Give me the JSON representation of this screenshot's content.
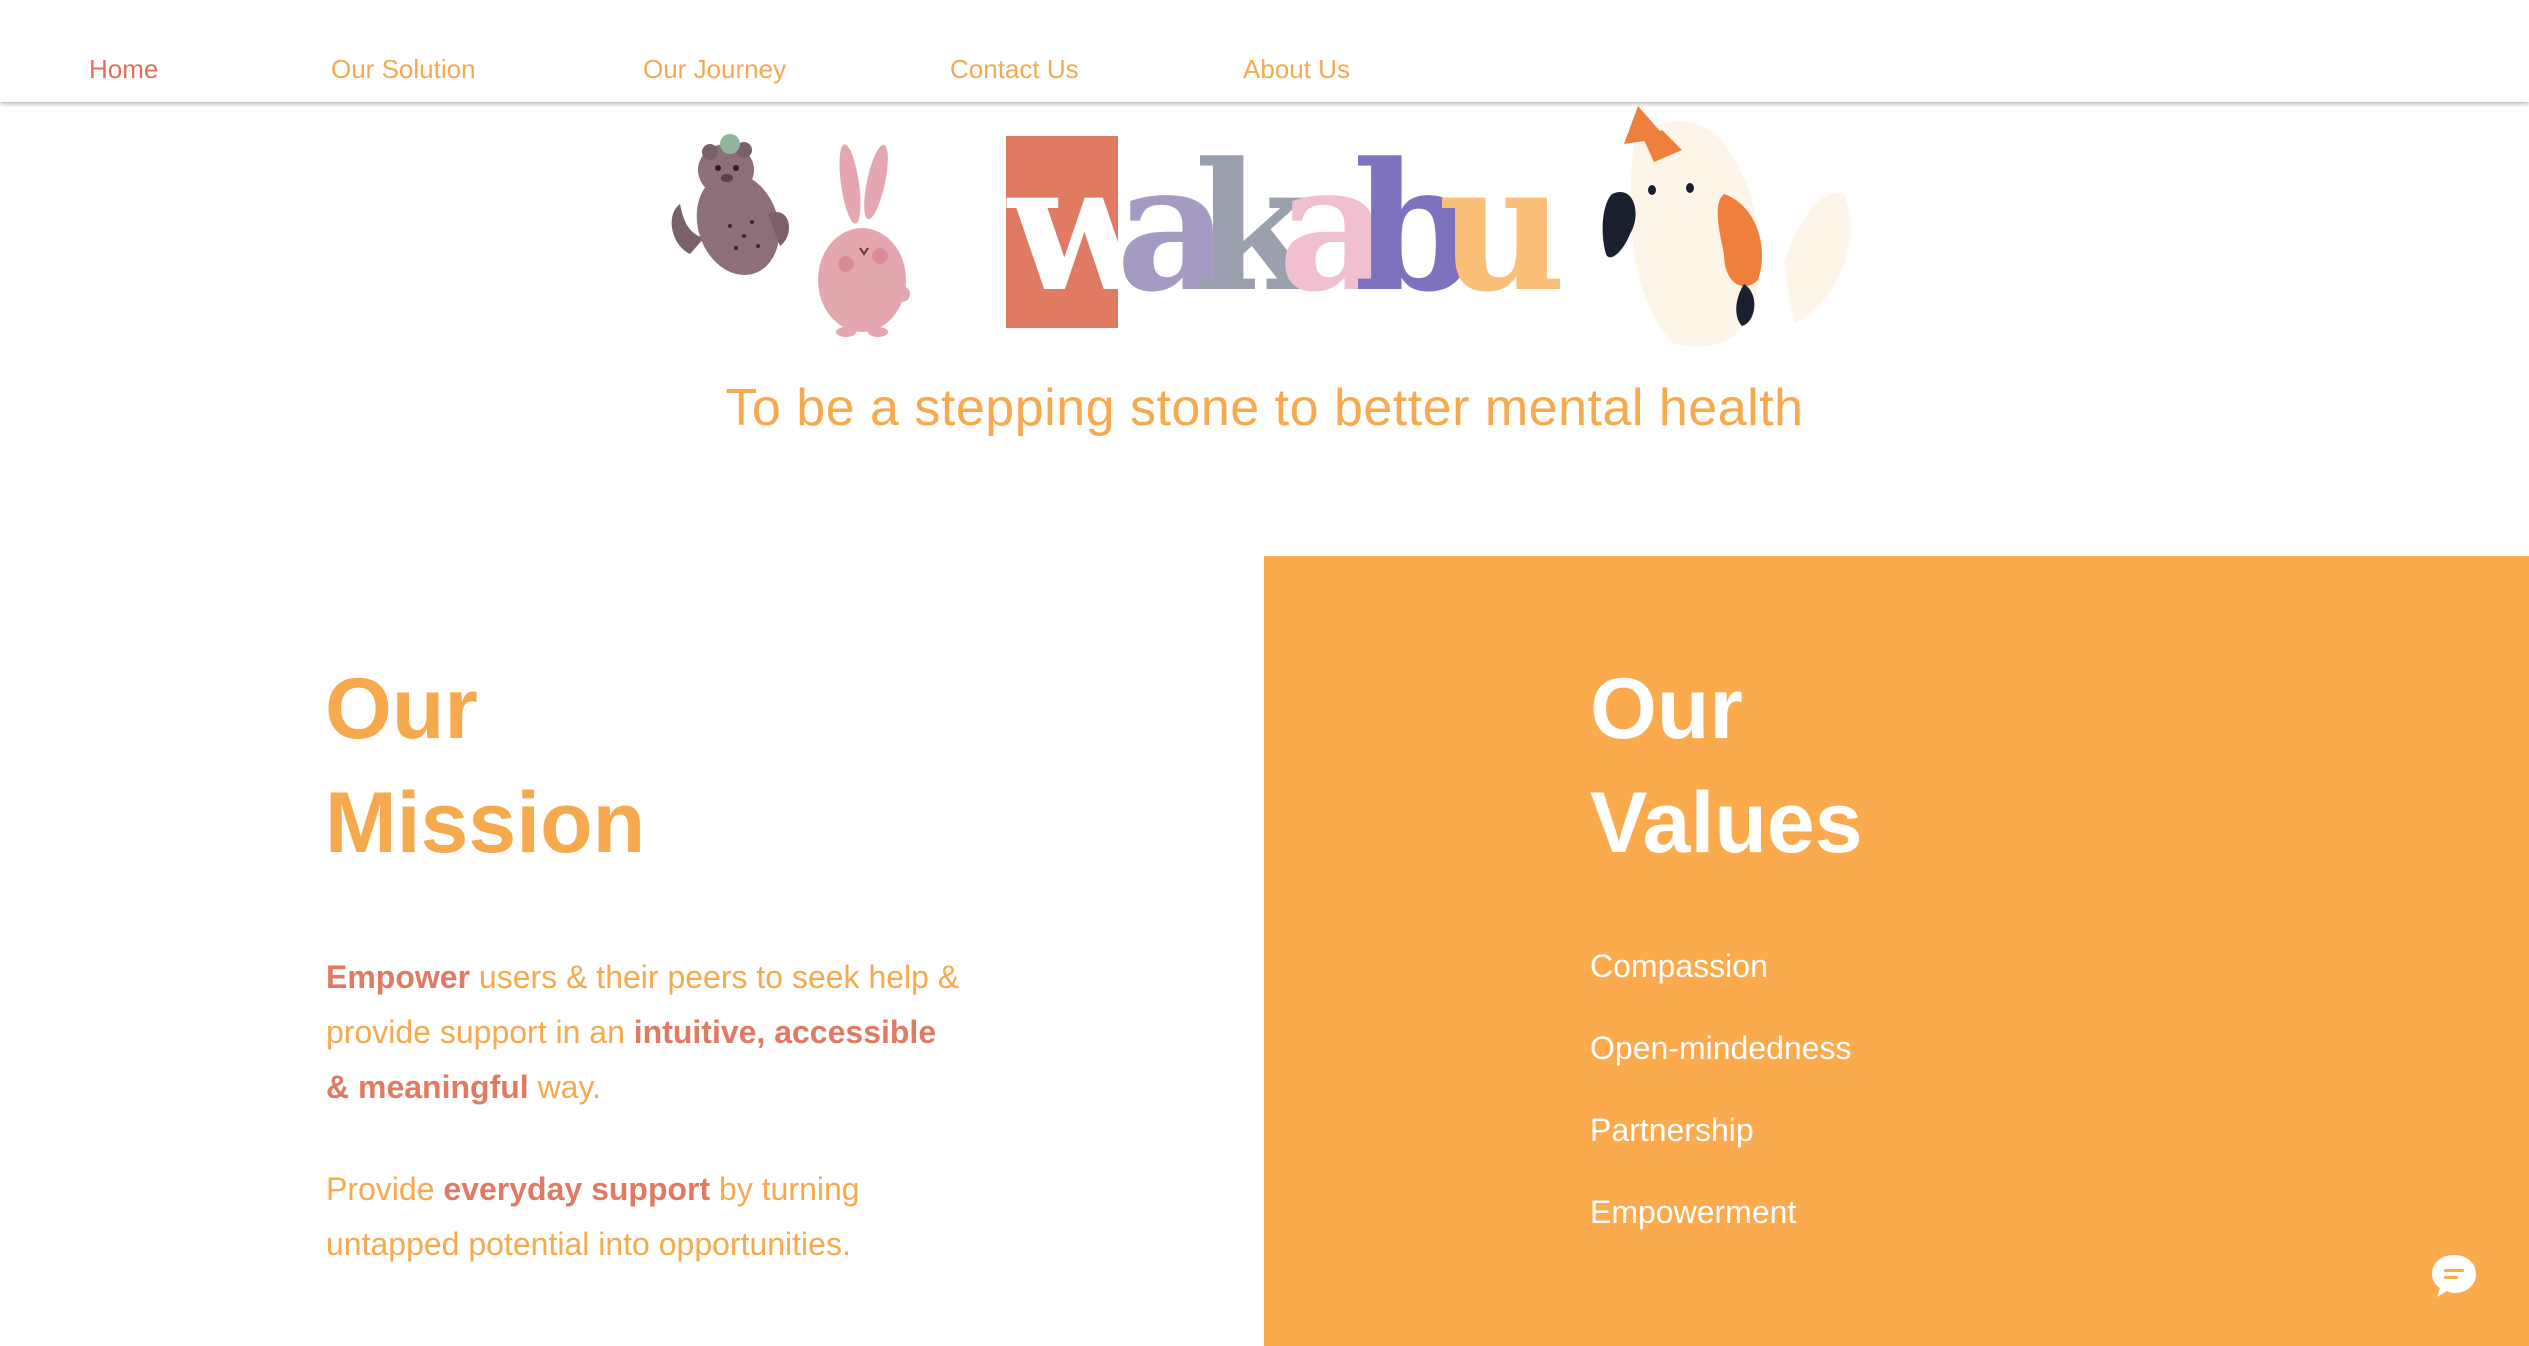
{
  "nav": {
    "items": [
      {
        "label": "Home"
      },
      {
        "label": "Our Solution"
      },
      {
        "label": "Our Journey"
      },
      {
        "label": "Contact Us"
      },
      {
        "label": "About Us"
      }
    ]
  },
  "hero": {
    "logo_letters": [
      "w",
      "a",
      "k",
      "a",
      "b",
      "u"
    ],
    "tagline": "To be a stepping stone to better mental health"
  },
  "mission": {
    "title_line1": "Our",
    "title_line2": "Mission",
    "p1": {
      "b1": "Empower",
      "t1": " users & their peers to seek help & provide support in an ",
      "b2": "intuitive, accessible & meaningful",
      "t2": " way."
    },
    "p2": {
      "t1": "Provide ",
      "b1": "everyday support",
      "t2": " by turning untapped potential into opportunities."
    }
  },
  "values": {
    "title_line1": "Our",
    "title_line2": "Values",
    "items": [
      {
        "label": "Compassion"
      },
      {
        "label": "Open-mindedness"
      },
      {
        "label": "Partnership"
      },
      {
        "label": "Empowerment"
      }
    ]
  },
  "colors": {
    "accent_orange": "#F6A94D",
    "accent_coral": "#E07A62",
    "panel_orange": "#FBAA4D",
    "logo_gray": "#9AA0AE",
    "logo_pink": "#F2BFCF",
    "logo_purple": "#7C72C0",
    "logo_lavender": "#A59AC4"
  },
  "icons": {
    "chat": "chat-bubble-icon",
    "bear": "otter-illustration-icon",
    "rabbit": "rabbit-illustration-icon",
    "cat": "calico-cat-illustration-icon"
  }
}
